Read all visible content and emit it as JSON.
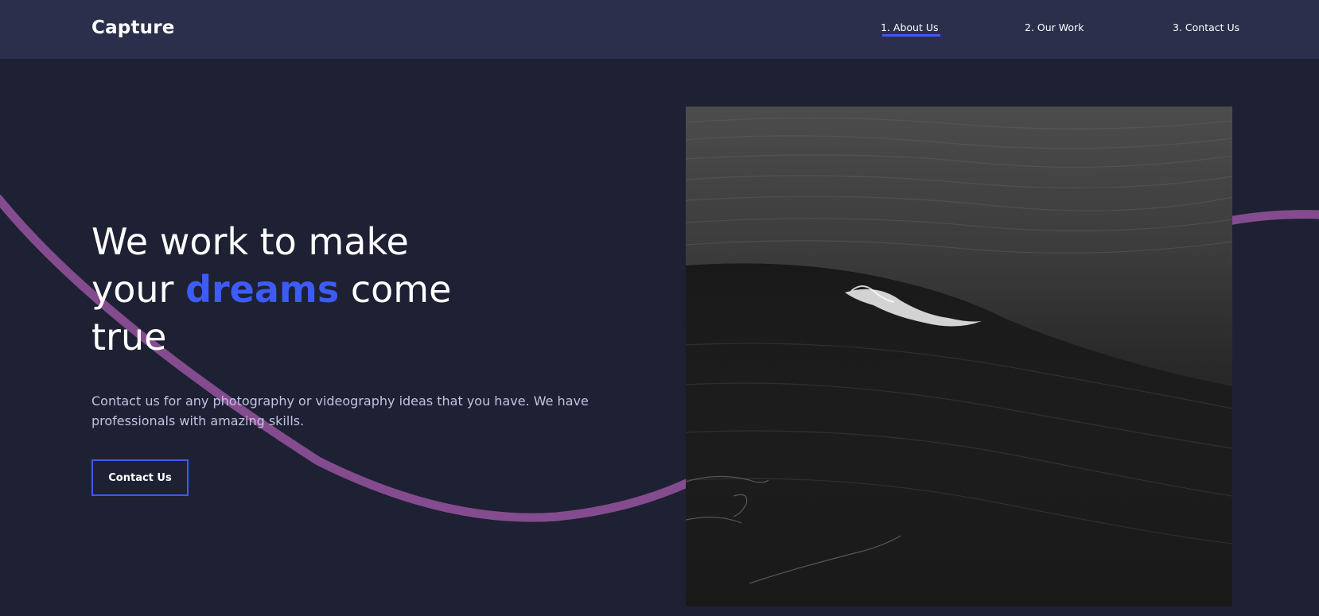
{
  "brand": {
    "logo": "Capture"
  },
  "nav": {
    "links": [
      {
        "label": "1. About Us",
        "active": true
      },
      {
        "label": "2. Our Work",
        "active": false
      },
      {
        "label": "3. Contact Us",
        "active": false
      }
    ]
  },
  "hero": {
    "title_line1": "We work to make",
    "title_line2_pre": "your ",
    "title_highlight": "dreams",
    "title_line2_post": " come",
    "title_line3": "true",
    "description": "Contact us for any photography or videography ideas that you have. We have professionals with amazing skills.",
    "cta_label": "Contact Us",
    "image_subject": "black-and-white ocean wave photograph"
  },
  "colors": {
    "background": "#1e2133",
    "navbar": "#2c2f4c",
    "accent": "#3d5bf6",
    "curve": "#844c8e",
    "text": "#ffffff",
    "muted_text": "#c0c3e2"
  }
}
